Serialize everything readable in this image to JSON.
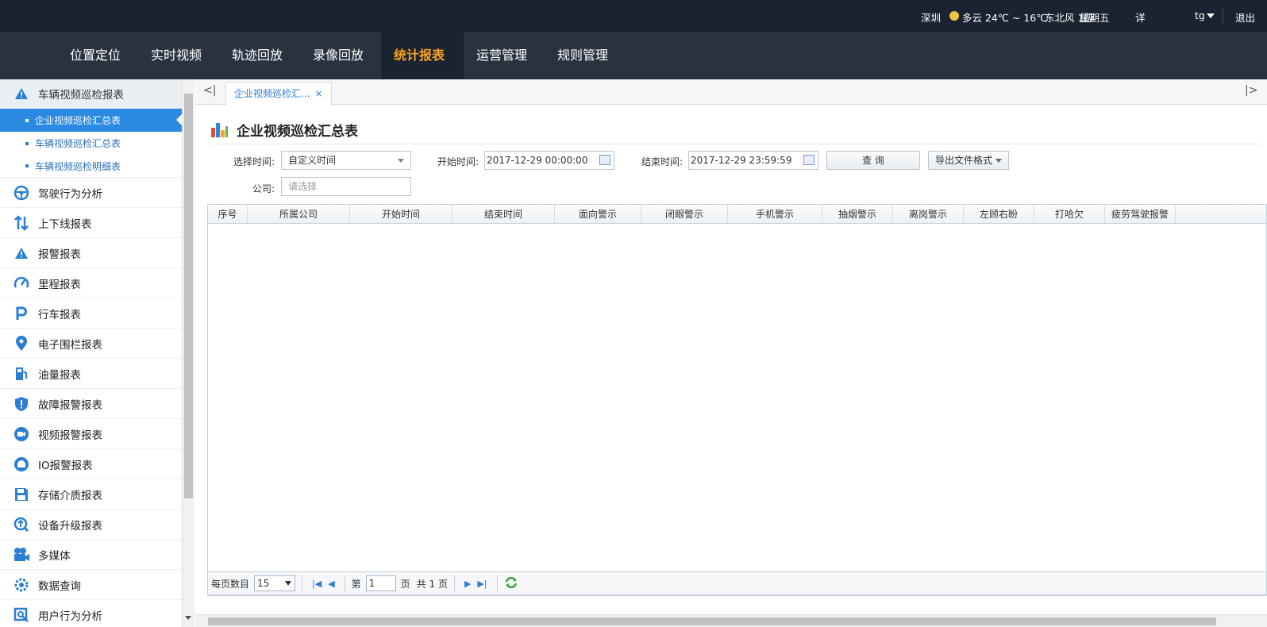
{
  "topbar": {
    "city": "深圳",
    "weather": "多云 24℃ ~ 16℃",
    "wind": "东北风 1级",
    "weekday": "星期五",
    "more": "详",
    "user": "tg",
    "logout": "退出"
  },
  "nav": [
    {
      "label": "位置定位"
    },
    {
      "label": "实时视频"
    },
    {
      "label": "轨迹回放"
    },
    {
      "label": "录像回放"
    },
    {
      "label": "统计报表",
      "active": true
    },
    {
      "label": "运营管理"
    },
    {
      "label": "规则管理"
    }
  ],
  "sidebar": {
    "group": "车辆视频巡检报表",
    "subitems": [
      "企业视频巡检汇总表",
      "车辆视频巡检汇总表",
      "车辆视频巡检明细表"
    ],
    "items": [
      {
        "label": "驾驶行为分析",
        "icon": "steering-wheel-icon"
      },
      {
        "label": "上下线报表",
        "icon": "updown-arrows-icon"
      },
      {
        "label": "报警报表",
        "icon": "warning-icon"
      },
      {
        "label": "里程报表",
        "icon": "speedometer-icon"
      },
      {
        "label": "行车报表",
        "icon": "parking-p-icon"
      },
      {
        "label": "电子围栏报表",
        "icon": "location-pin-icon"
      },
      {
        "label": "油量报表",
        "icon": "fuel-pump-icon"
      },
      {
        "label": "故障报警报表",
        "icon": "shield-alert-icon"
      },
      {
        "label": "视频报警报表",
        "icon": "video-camera-icon"
      },
      {
        "label": "IO报警报表",
        "icon": "alarm-light-icon"
      },
      {
        "label": "存储介质报表",
        "icon": "floppy-disk-icon"
      },
      {
        "label": "设备升级报表",
        "icon": "upgrade-icon"
      },
      {
        "label": "多媒体",
        "icon": "multimedia-camera-icon"
      },
      {
        "label": "数据查询",
        "icon": "data-gear-icon"
      },
      {
        "label": "用户行为分析",
        "icon": "user-search-icon"
      }
    ]
  },
  "tabs": {
    "left": "<|",
    "right": "|>",
    "active": "企业视频巡检汇...",
    "close": "×"
  },
  "page": {
    "title": "企业视频巡检汇总表",
    "filters": {
      "time_label": "选择时间:",
      "time_value": "自定义时间",
      "start_label": "开始时间:",
      "start_value": "2017-12-29 00:00:00",
      "end_label": "结束时间:",
      "end_value": "2017-12-29 23:59:59",
      "query_button": "查 询",
      "export_button": "导出文件格式",
      "company_label": "公司:",
      "company_placeholder": "请选择"
    },
    "columns": [
      "序号",
      "所属公司",
      "开始时间",
      "结束时间",
      "面向警示",
      "闭眼警示",
      "手机警示",
      "抽烟警示",
      "离岗警示",
      "左顾右盼",
      "打哈欠",
      "疲劳驾驶报警"
    ],
    "pager": {
      "per_page_label": "每页数目",
      "per_page_value": "15",
      "page_prefix": "第",
      "page_value": "1",
      "page_suffix": "页",
      "total": "共 1 页"
    }
  },
  "colors": {
    "accent": "#2a89e0",
    "nav_active": "#f7a21b",
    "topbar": "#1b2331",
    "nav_bg": "#2a3240"
  }
}
